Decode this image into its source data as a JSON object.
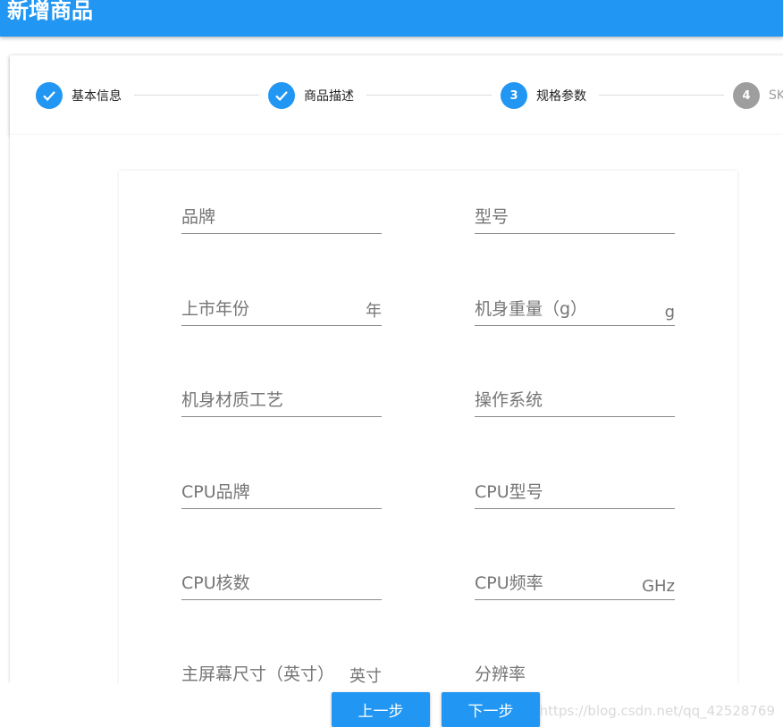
{
  "header": {
    "title": "新增商品"
  },
  "colors": {
    "primary": "#2196f3",
    "pending": "#9e9e9e"
  },
  "stepper": {
    "steps": [
      {
        "number": "",
        "label": "基本信息",
        "state": "done",
        "icon": "check-icon"
      },
      {
        "number": "",
        "label": "商品描述",
        "state": "done",
        "icon": "check-icon"
      },
      {
        "number": "3",
        "label": "规格参数",
        "state": "active"
      },
      {
        "number": "4",
        "label": "SK",
        "state": "pending"
      }
    ]
  },
  "form": {
    "fields": [
      {
        "label": "品牌",
        "suffix": ""
      },
      {
        "label": "型号",
        "suffix": ""
      },
      {
        "label": "上市年份",
        "suffix": "年"
      },
      {
        "label": "机身重量（g）",
        "suffix": "g"
      },
      {
        "label": "机身材质工艺",
        "suffix": ""
      },
      {
        "label": "操作系统",
        "suffix": ""
      },
      {
        "label": "CPU品牌",
        "suffix": ""
      },
      {
        "label": "CPU型号",
        "suffix": ""
      },
      {
        "label": "CPU核数",
        "suffix": ""
      },
      {
        "label": "CPU频率",
        "suffix": "GHz"
      },
      {
        "label": "主屏幕尺寸（英寸）",
        "suffix": "英寸"
      },
      {
        "label": "分辨率",
        "suffix": ""
      }
    ]
  },
  "actions": {
    "prev_label": "上一步",
    "next_label": "下一步"
  },
  "watermark": "https://blog.csdn.net/qq_42528769"
}
